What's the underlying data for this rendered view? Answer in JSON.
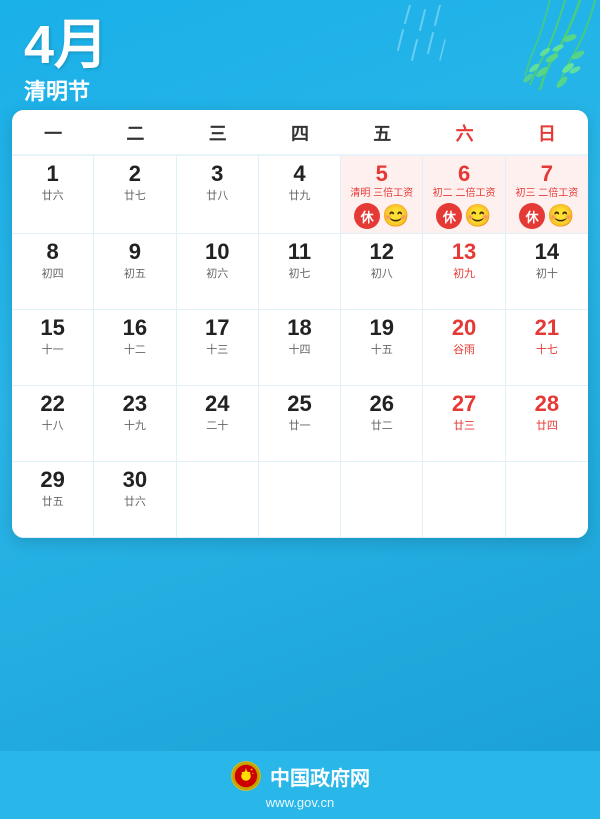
{
  "header": {
    "month": "4月",
    "festival": "清明节"
  },
  "weekdays": [
    {
      "label": "一",
      "is_weekend": false
    },
    {
      "label": "二",
      "is_weekend": false
    },
    {
      "label": "三",
      "is_weekend": false
    },
    {
      "label": "四",
      "is_weekend": false
    },
    {
      "label": "五",
      "is_weekend": false
    },
    {
      "label": "六",
      "is_weekend": true
    },
    {
      "label": "日",
      "is_weekend": true
    }
  ],
  "days": [
    {
      "day": "1",
      "lunar": "廿六",
      "red": false,
      "holiday_label": "",
      "rest": false,
      "smile": false,
      "empty": false
    },
    {
      "day": "2",
      "lunar": "廿七",
      "red": false,
      "holiday_label": "",
      "rest": false,
      "smile": false,
      "empty": false
    },
    {
      "day": "3",
      "lunar": "廿八",
      "red": false,
      "holiday_label": "",
      "rest": false,
      "smile": false,
      "empty": false
    },
    {
      "day": "4",
      "lunar": "廿九",
      "red": false,
      "holiday_label": "",
      "rest": false,
      "smile": false,
      "empty": false
    },
    {
      "day": "5",
      "lunar": "清明\n三倍工资",
      "red": true,
      "holiday_label": "清明\n三倍工资",
      "rest": true,
      "smile": true,
      "empty": false
    },
    {
      "day": "6",
      "lunar": "初二\n二倍工资",
      "red": true,
      "holiday_label": "初二\n二倍工资",
      "rest": true,
      "smile": true,
      "empty": false
    },
    {
      "day": "7",
      "lunar": "初三\n二倍工资",
      "red": true,
      "holiday_label": "初三\n二倍工资",
      "rest": true,
      "smile": true,
      "empty": false
    },
    {
      "day": "8",
      "lunar": "初四",
      "red": false,
      "holiday_label": "",
      "rest": false,
      "smile": false,
      "empty": false
    },
    {
      "day": "9",
      "lunar": "初五",
      "red": false,
      "holiday_label": "",
      "rest": false,
      "smile": false,
      "empty": false
    },
    {
      "day": "10",
      "lunar": "初六",
      "red": false,
      "holiday_label": "",
      "rest": false,
      "smile": false,
      "empty": false
    },
    {
      "day": "11",
      "lunar": "初七",
      "red": false,
      "holiday_label": "",
      "rest": false,
      "smile": false,
      "empty": false
    },
    {
      "day": "12",
      "lunar": "初八",
      "red": false,
      "holiday_label": "",
      "rest": false,
      "smile": false,
      "empty": false
    },
    {
      "day": "13",
      "lunar": "初九",
      "red": true,
      "holiday_label": "",
      "rest": false,
      "smile": false,
      "empty": false
    },
    {
      "day": "14",
      "lunar": "初十",
      "red": false,
      "holiday_label": "",
      "rest": false,
      "smile": false,
      "empty": false
    },
    {
      "day": "15",
      "lunar": "十一",
      "red": false,
      "holiday_label": "",
      "rest": false,
      "smile": false,
      "empty": false
    },
    {
      "day": "16",
      "lunar": "十二",
      "red": false,
      "holiday_label": "",
      "rest": false,
      "smile": false,
      "empty": false
    },
    {
      "day": "17",
      "lunar": "十三",
      "red": false,
      "holiday_label": "",
      "rest": false,
      "smile": false,
      "empty": false
    },
    {
      "day": "18",
      "lunar": "十四",
      "red": false,
      "holiday_label": "",
      "rest": false,
      "smile": false,
      "empty": false
    },
    {
      "day": "19",
      "lunar": "十五",
      "red": false,
      "holiday_label": "",
      "rest": false,
      "smile": false,
      "empty": false
    },
    {
      "day": "20",
      "lunar": "谷雨",
      "red": true,
      "holiday_label": "",
      "rest": false,
      "smile": false,
      "empty": false
    },
    {
      "day": "21",
      "lunar": "十七",
      "red": true,
      "holiday_label": "",
      "rest": false,
      "smile": false,
      "empty": false
    },
    {
      "day": "22",
      "lunar": "十八",
      "red": false,
      "holiday_label": "",
      "rest": false,
      "smile": false,
      "empty": false
    },
    {
      "day": "23",
      "lunar": "十九",
      "red": false,
      "holiday_label": "",
      "rest": false,
      "smile": false,
      "empty": false
    },
    {
      "day": "24",
      "lunar": "二十",
      "red": false,
      "holiday_label": "",
      "rest": false,
      "smile": false,
      "empty": false
    },
    {
      "day": "25",
      "lunar": "廿一",
      "red": false,
      "holiday_label": "",
      "rest": false,
      "smile": false,
      "empty": false
    },
    {
      "day": "26",
      "lunar": "廿二",
      "red": false,
      "holiday_label": "",
      "rest": false,
      "smile": false,
      "empty": false
    },
    {
      "day": "27",
      "lunar": "廿三",
      "red": true,
      "holiday_label": "",
      "rest": false,
      "smile": false,
      "empty": false
    },
    {
      "day": "28",
      "lunar": "廿四",
      "red": true,
      "holiday_label": "",
      "rest": false,
      "smile": false,
      "empty": false
    },
    {
      "day": "29",
      "lunar": "廿五",
      "red": false,
      "holiday_label": "",
      "rest": false,
      "smile": false,
      "empty": false
    },
    {
      "day": "30",
      "lunar": "廿六",
      "red": false,
      "holiday_label": "",
      "rest": false,
      "smile": false,
      "empty": false
    },
    {
      "day": "",
      "lunar": "",
      "red": false,
      "holiday_label": "",
      "rest": false,
      "smile": false,
      "empty": true
    },
    {
      "day": "",
      "lunar": "",
      "red": false,
      "holiday_label": "",
      "rest": false,
      "smile": false,
      "empty": true
    },
    {
      "day": "",
      "lunar": "",
      "red": false,
      "holiday_label": "",
      "rest": false,
      "smile": false,
      "empty": true
    },
    {
      "day": "",
      "lunar": "",
      "red": false,
      "holiday_label": "",
      "rest": false,
      "smile": false,
      "empty": true
    },
    {
      "day": "",
      "lunar": "",
      "red": false,
      "holiday_label": "",
      "rest": false,
      "smile": false,
      "empty": true
    }
  ],
  "footer": {
    "site_name": "中国政府网",
    "url": "www.gov.cn"
  },
  "colors": {
    "blue": "#29b6e8",
    "red": "#e53935",
    "white": "#ffffff"
  }
}
